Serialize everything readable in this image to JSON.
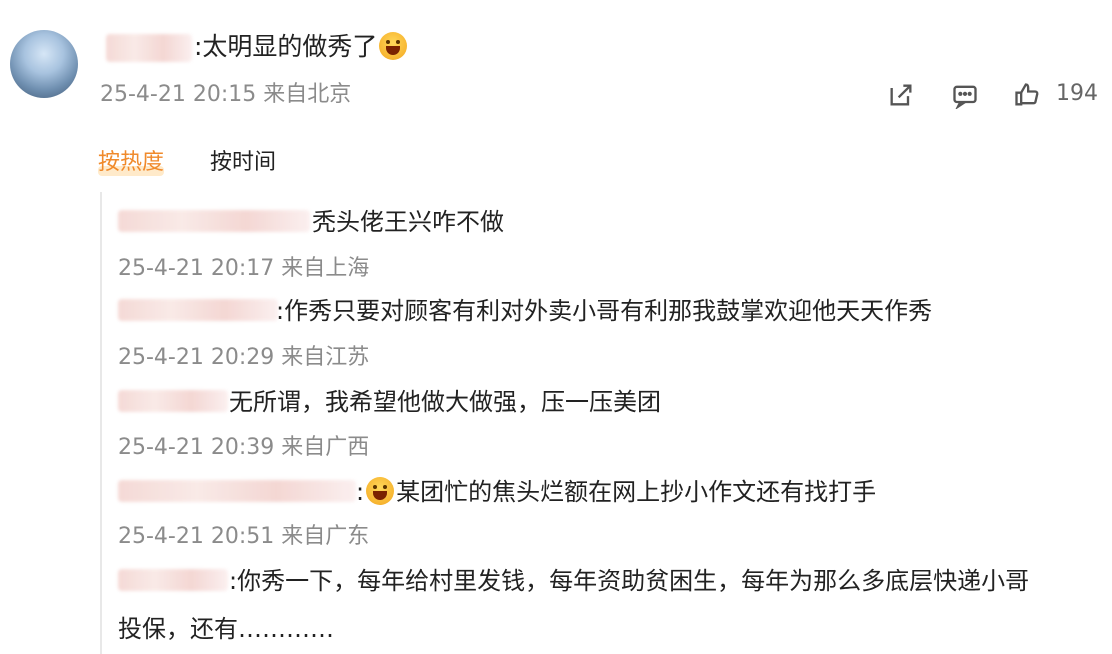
{
  "comment": {
    "text": ":太明显的做秀了",
    "time": "25-4-21 20:15",
    "location": "来自北京",
    "like_count": "194"
  },
  "sort": {
    "active": "按热度",
    "other": "按时间"
  },
  "replies": [
    {
      "text": "秃头佬王兴咋不做",
      "time": "25-4-21 20:17",
      "location": "来自上海"
    },
    {
      "text": ":作秀只要对顾客有利对外卖小哥有利那我鼓掌欢迎他天天作秀",
      "time": "25-4-21 20:29",
      "location": "来自江苏"
    },
    {
      "text": "无所谓，我希望他做大做强，压一压美团",
      "time": "25-4-21 20:39",
      "location": "来自广西"
    },
    {
      "text": ":",
      "text2": "某团忙的焦头烂额在网上抄小作文还有找打手",
      "time": "25-4-21 20:51",
      "location": "来自广东"
    },
    {
      "text": ":你秀一下，每年给村里发钱，每年资助贫困生，每年为那么多底层快递小哥",
      "text_line2": "投保，还有…………"
    }
  ],
  "icons": [
    "avatar",
    "share-icon",
    "comment-icon",
    "like-icon",
    "laughing-emoji"
  ]
}
